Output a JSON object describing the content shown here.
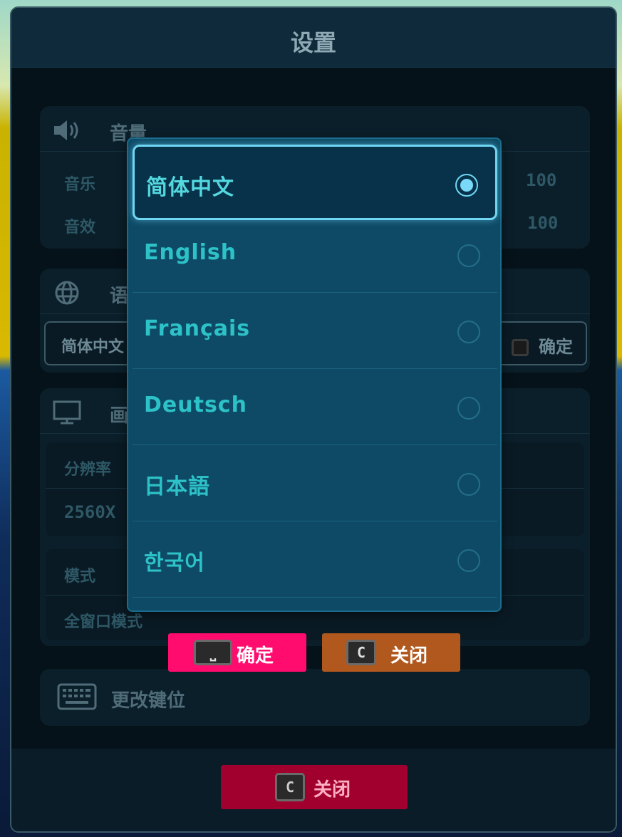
{
  "title": "设置",
  "volume": {
    "header": "音量",
    "music_label": "音乐",
    "music_value": "100",
    "sfx_label": "音效",
    "sfx_value": "100"
  },
  "language": {
    "header": "语",
    "current_value": "简体中文",
    "confirm_label": "确定"
  },
  "display": {
    "header": "画",
    "resolution_label": "分辨率",
    "resolution_value": "2560X",
    "mode_label": "模式",
    "mode_value": "全窗口模式"
  },
  "keybind": {
    "label": "更改键位"
  },
  "dropdown": {
    "options": [
      {
        "label": "简体中文",
        "selected": true
      },
      {
        "label": "English",
        "selected": false
      },
      {
        "label": "Français",
        "selected": false
      },
      {
        "label": "Deutsch",
        "selected": false
      },
      {
        "label": "日本語",
        "selected": false
      },
      {
        "label": "한국어",
        "selected": false
      }
    ]
  },
  "dropdown_actions": {
    "confirm_label": "确定",
    "confirm_key": "⎵",
    "close_label": "关闭",
    "close_key": "C"
  },
  "footer": {
    "close_label": "关闭",
    "close_key": "C"
  },
  "colors": {
    "accent": "#6fd6f4",
    "confirm_button": "#ff0c6e",
    "close_button": "#b0581e",
    "footer_close": "#a1002e"
  }
}
